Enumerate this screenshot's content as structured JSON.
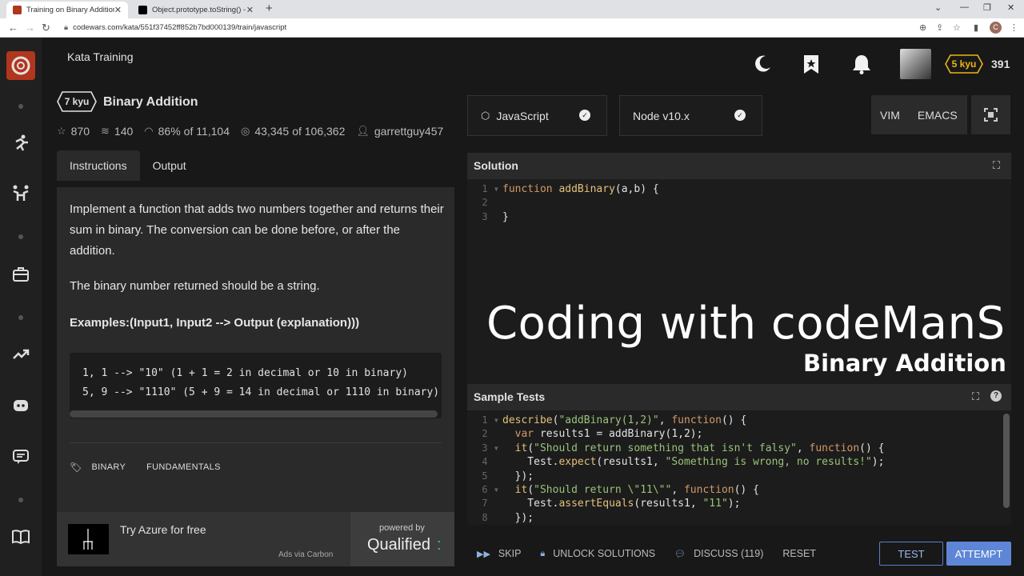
{
  "browser": {
    "tabs": [
      {
        "title": "Training on Binary Addition | Co",
        "close": "✕"
      },
      {
        "title": "Object.prototype.toString() - Java",
        "close": "✕"
      }
    ],
    "new_tab": "+",
    "url": "codewars.com/kata/551f37452ff852b7bd000139/train/javascript",
    "profile_initial": "C"
  },
  "header": {
    "title": "Kata Training",
    "rank": "5 kyu",
    "honor": "391"
  },
  "kata": {
    "kyu": "7 kyu",
    "name": "Binary Addition",
    "stats": {
      "stars": "870",
      "collections": "140",
      "satisfaction": "86%",
      "satisfaction_of": "of 11,104",
      "completed": "43,345",
      "completed_of": "of 106,362",
      "author": "garrettguy457"
    },
    "tabs": [
      "Instructions",
      "Output"
    ],
    "description": {
      "p1": "Implement a function that adds two numbers together and returns their sum in binary. The conversion can be done before, or after the addition.",
      "p2": "The binary number returned should be a string.",
      "p3": "Examples:(Input1, Input2 --> Output (explanation)))",
      "code": "1, 1 --> \"10\" (1 + 1 = 2 in decimal or 10 in binary)\n5, 9 --> \"1110\" (5 + 9 = 14 in decimal or 1110 in binary)"
    },
    "tags": [
      "BINARY",
      "FUNDAMENTALS"
    ]
  },
  "ad": {
    "text": "Try Azure for free",
    "via": "Ads via Carbon",
    "powered_by": "powered by",
    "brand": "Qualified"
  },
  "editor": {
    "language": "JavaScript",
    "runtime": "Node v10.x",
    "modes": [
      "VIM",
      "EMACS"
    ],
    "solution_title": "Solution",
    "tests_title": "Sample Tests",
    "overlay_title": "Coding with codeManS",
    "overlay_subtitle": "Binary Addition"
  },
  "actions": {
    "skip": "SKIP",
    "unlock": "UNLOCK SOLUTIONS",
    "discuss": "DISCUSS (119)",
    "reset": "RESET",
    "test": "TEST",
    "attempt": "ATTEMPT"
  },
  "colors": {
    "accent": "#5d86d6",
    "brand": "#b1361e",
    "rank_badge": "#ecb613"
  }
}
